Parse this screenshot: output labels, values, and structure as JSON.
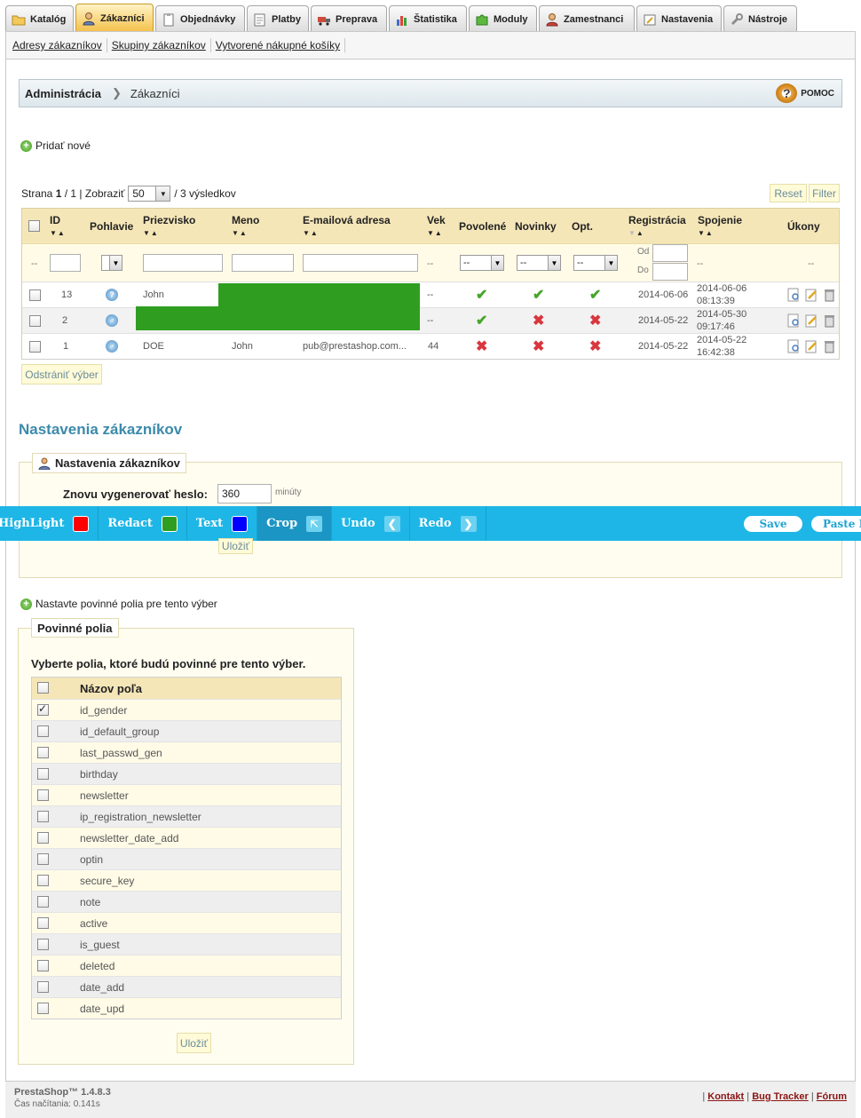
{
  "tabs": [
    {
      "label": "Katalóg",
      "icon": "folder-icon"
    },
    {
      "label": "Zákazníci",
      "icon": "customer-icon",
      "active": true
    },
    {
      "label": "Objednávky",
      "icon": "clipboard-icon"
    },
    {
      "label": "Platby",
      "icon": "payment-icon"
    },
    {
      "label": "Preprava",
      "icon": "truck-icon"
    },
    {
      "label": "Štatistika",
      "icon": "chart-icon"
    },
    {
      "label": "Moduly",
      "icon": "puzzle-icon"
    },
    {
      "label": "Zamestnanci",
      "icon": "employee-icon"
    },
    {
      "label": "Nastavenia",
      "icon": "settings-icon"
    },
    {
      "label": "Nástroje",
      "icon": "wrench-icon"
    }
  ],
  "subnav": [
    "Adresy zákazníkov",
    "Skupiny zákazníkov",
    "Vytvorené nákupné košíky"
  ],
  "breadcrumb": {
    "root": "Administrácia",
    "current": "Zákazníci",
    "help": "POMOC"
  },
  "add_new": "Pridať nové",
  "pager": {
    "prefix": "Strana",
    "page": "1",
    "total": "/ 1 | Zobraziť",
    "per_page": "50",
    "results": "/ 3 výsledkov"
  },
  "buttons": {
    "reset": "Reset",
    "filter": "Filter",
    "delete_selected": "Odstrániť výber",
    "save": "Uložiť",
    "save2": "Uložiť"
  },
  "columns": {
    "id": "ID",
    "gender": "Pohlavie",
    "lastname": "Priezvisko",
    "firstname": "Meno",
    "email": "E-mailová adresa",
    "age": "Vek",
    "active": "Povolené",
    "newsletter": "Novinky",
    "optin": "Opt.",
    "registration": "Registrácia",
    "connection": "Spojenie",
    "actions": "Úkony"
  },
  "filters": {
    "dash": "--",
    "from": "Od",
    "to": "Do"
  },
  "rows": [
    {
      "id": "13",
      "lastname": "John",
      "firstname": "",
      "email": "",
      "age": "--",
      "active": true,
      "newsletter": true,
      "optin": true,
      "registration": "2014-06-06",
      "connection_date": "2014-06-06",
      "connection_time": "08:13:39",
      "gender_icon": "unknown-gender-icon"
    },
    {
      "id": "2",
      "lastname": "",
      "firstname": "",
      "email": "",
      "age": "--",
      "active": true,
      "newsletter": false,
      "optin": false,
      "registration": "2014-05-22",
      "connection_date": "2014-05-30",
      "connection_time": "09:17:46",
      "gender_icon": "male-icon"
    },
    {
      "id": "1",
      "lastname": "DOE",
      "firstname": "John",
      "email": "pub@prestashop.com...",
      "age": "44",
      "active": false,
      "newsletter": false,
      "optin": false,
      "registration": "2014-05-22",
      "connection_date": "2014-05-22",
      "connection_time": "16:42:38",
      "gender_icon": "male-icon"
    }
  ],
  "settings": {
    "heading": "Nastavenia zákazníkov",
    "legend": "Nastavenia zákazníkov",
    "regen_label": "Znovu vygenerovať heslo:",
    "regen_value": "360",
    "regen_unit": "minúty"
  },
  "toolbar": {
    "highlight": "HighLight",
    "redact": "Redact",
    "text": "Text",
    "crop": "Crop",
    "undo": "Undo",
    "redo": "Redo",
    "save": "Save",
    "paste": "Paste It",
    "colors": {
      "highlight": "#ff0000",
      "redact": "#2f9e20",
      "text": "#0000ff"
    }
  },
  "required": {
    "link": "Nastavte povinné polia pre tento výber",
    "legend": "Povinné polia",
    "intro": "Vyberte polia, ktoré budú povinné pre tento výber.",
    "column": "Názov poľa",
    "fields": [
      {
        "name": "id_gender",
        "checked": true
      },
      {
        "name": "id_default_group",
        "checked": false
      },
      {
        "name": "last_passwd_gen",
        "checked": false
      },
      {
        "name": "birthday",
        "checked": false
      },
      {
        "name": "newsletter",
        "checked": false
      },
      {
        "name": "ip_registration_newsletter",
        "checked": false
      },
      {
        "name": "newsletter_date_add",
        "checked": false
      },
      {
        "name": "optin",
        "checked": false
      },
      {
        "name": "secure_key",
        "checked": false
      },
      {
        "name": "note",
        "checked": false
      },
      {
        "name": "active",
        "checked": false
      },
      {
        "name": "is_guest",
        "checked": false
      },
      {
        "name": "deleted",
        "checked": false
      },
      {
        "name": "date_add",
        "checked": false
      },
      {
        "name": "date_upd",
        "checked": false
      }
    ]
  },
  "footer": {
    "version": "PrestaShop™ 1.4.8.3",
    "sub": "Čas načítania: 0.141s",
    "links": [
      "Kontakt",
      "Bug Tracker",
      "Fórum"
    ]
  }
}
